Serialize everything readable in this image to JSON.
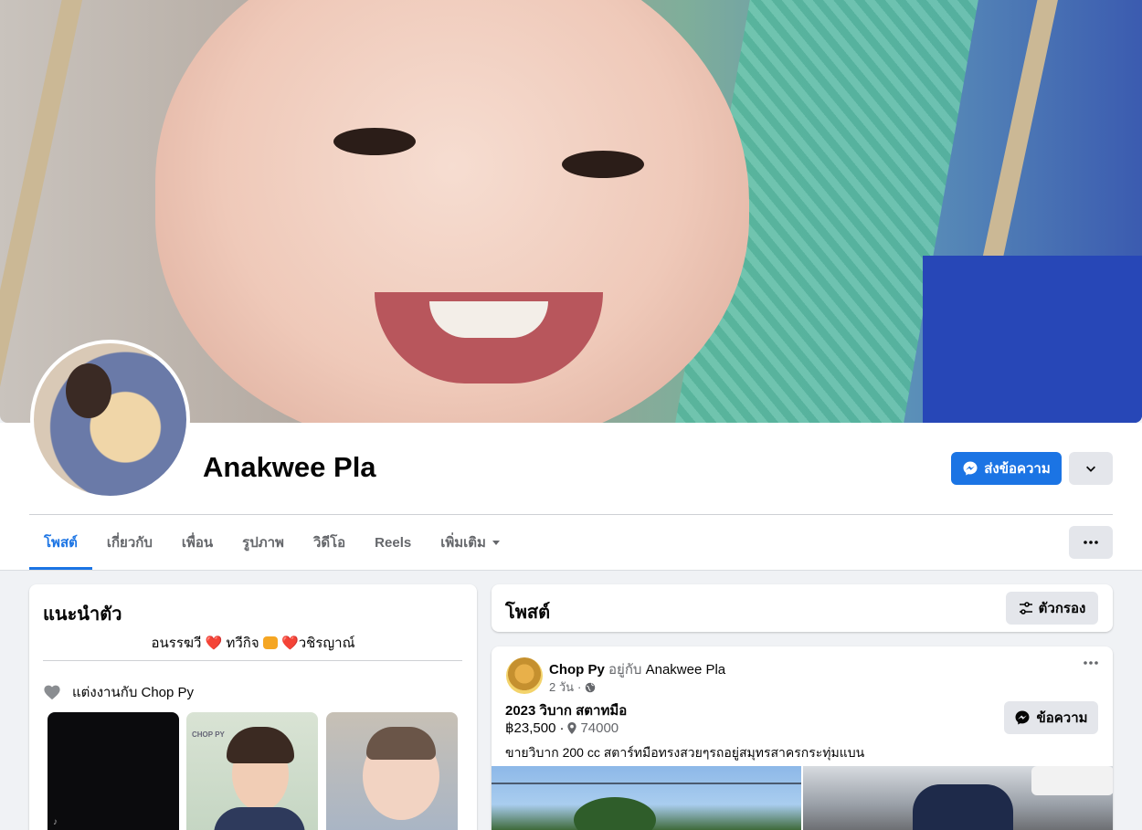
{
  "profile": {
    "name": "Anakwee Pla",
    "message_button": "ส่งข้อความ"
  },
  "tabs": [
    {
      "label": "โพสต์"
    },
    {
      "label": "เกี่ยวกับ"
    },
    {
      "label": "เพื่อน"
    },
    {
      "label": "รูปภาพ"
    },
    {
      "label": "วิดีโอ"
    },
    {
      "label": "Reels"
    },
    {
      "label": "เพิ่มเติม"
    }
  ],
  "intro": {
    "title": "แนะนำตัว",
    "bio_part1": "อนรรฆวี",
    "bio_part2": "ทวีกิจ",
    "bio_part3": "วชิรญาณ์",
    "relationship": "แต่งงานกับ Chop Py",
    "photo_label": "CHOP PY"
  },
  "posts_header": {
    "title": "โพสต์",
    "filter_button": "ตัวกรอง"
  },
  "post": {
    "author": "Chop Py",
    "with_text": "อยู่กับ",
    "tagged": "Anakwee Pla",
    "time": "2 วัน",
    "listing_title": "2023 วิบาก สตาทมือ",
    "price": "฿23,500",
    "location": "74000",
    "message_button": "ข้อความ",
    "description": "ขายวิบาก 200 cc สตาร์ทมือทรงสวยๆรถอยู่สมุทรสาครกระทุ่มแบน"
  },
  "colors": {
    "accent": "#1b74e4",
    "background": "#f0f2f5",
    "secondary_text": "#65676b"
  }
}
